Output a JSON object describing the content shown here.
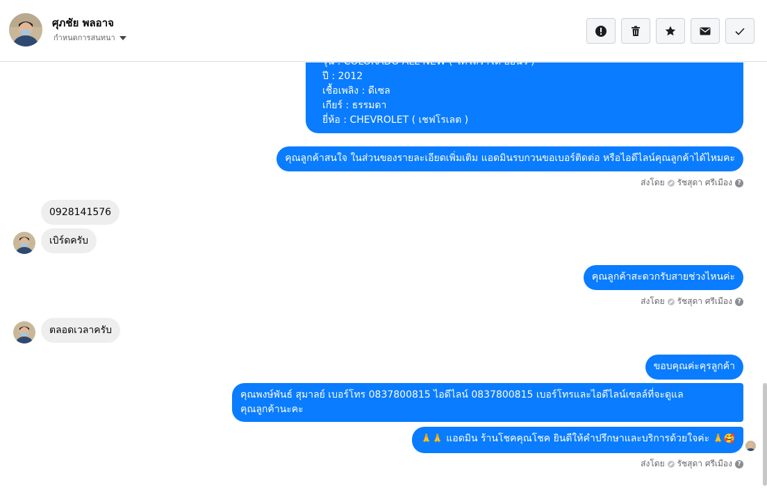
{
  "header": {
    "contact_name": "ศุภชัย พลอาจ",
    "subtitle": "กำหนดการสนทนา",
    "actions": [
      {
        "name": "report-button",
        "icon": "exclamation-circle-icon"
      },
      {
        "name": "delete-button",
        "icon": "trash-icon"
      },
      {
        "name": "star-button",
        "icon": "star-icon"
      },
      {
        "name": "mark-unread-button",
        "icon": "envelope-icon"
      },
      {
        "name": "done-button",
        "icon": "check-icon"
      }
    ]
  },
  "messages": {
    "m1_line1": "รุ่น : COLORADO ALL NEW ( โคโลราโด ออนิว )",
    "m1_line2": "ปี : 2012",
    "m1_line3": "เชื้อเพลิง : ดีเซล",
    "m1_line4": "เกียร์ : ธรรมดา",
    "m1_line5": "ยี่ห้อ : CHEVROLET ( เชฟโรเลต )",
    "m2": "คุณลูกค้าสนใจ ในส่วนของรายละเอียดเพิ่มเติม แอดมินรบกวนขอเบอร์ติดต่อ หรือไอดีไลน์คุณลูกค้าได้ไหมคะ",
    "m3": "0928141576",
    "m4": "เบิร์ดครับ",
    "m5": "คุณลูกค้าสะดวกรับสายช่วงไหนค่ะ",
    "m6": "ตลอดเวลาครับ",
    "m7": "ขอบคุณค่ะคุรลูกค้า",
    "m8_line1": "คุณพงษ์พันธ์ สุมาลย์      เบอร์โทร 0837800815  ไอดีไลน์ 0837800815   เบอร์โทรและไอดีไลน์เซลล์ที่จะดูแล",
    "m8_line2": "คุณลูกค้านะคะ",
    "m9_prefix": "🙏🙏",
    "m9_text": "แอดมิน ร้านโชคคุณโชค ยินดีให้คำปรึกษาและบริการด้วยใจค่ะ",
    "m9_suffix": "🙏🥰"
  },
  "sent_by": {
    "label": "ส่งโดย",
    "agent": "รัชสุดา ศรีเมือง",
    "help": "?"
  },
  "colors": {
    "outgoing_bubble": "#0a7cff",
    "incoming_bubble": "#eeeeee"
  }
}
